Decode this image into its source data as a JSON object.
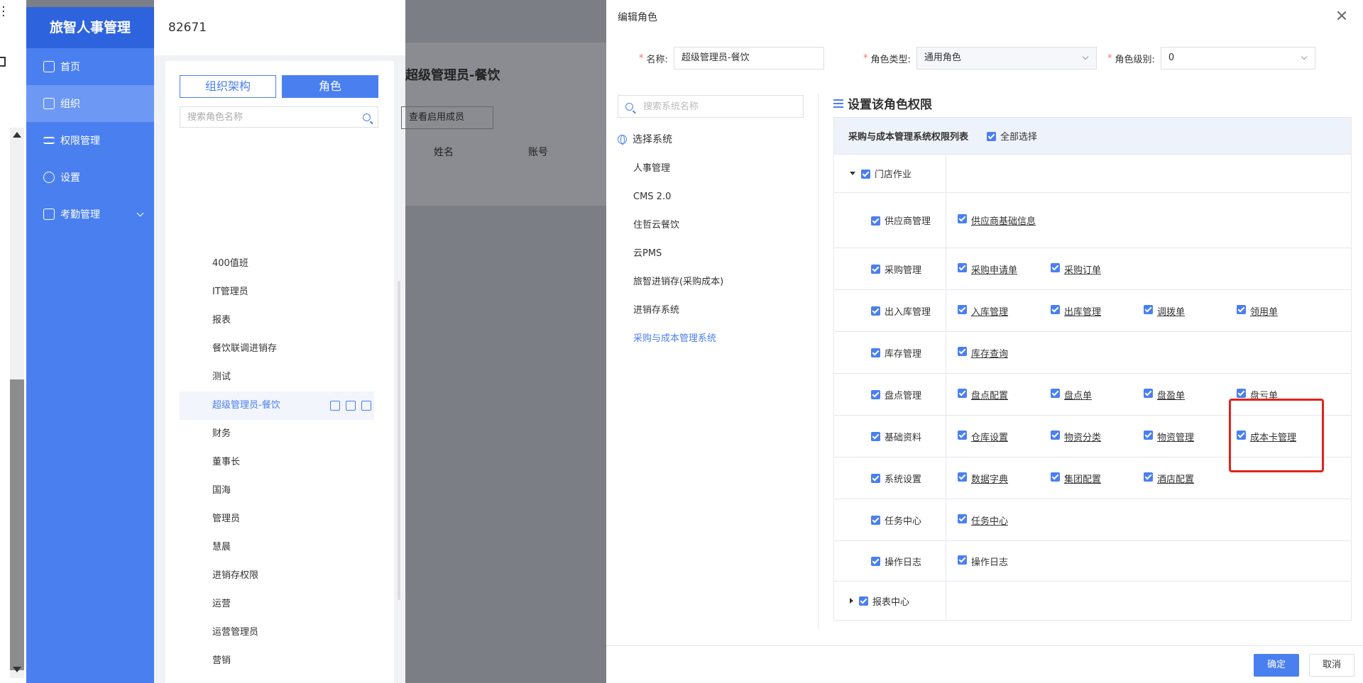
{
  "sidebar": {
    "brand": "旅智人事管理",
    "items": [
      {
        "label": "首页"
      },
      {
        "label": "组织"
      },
      {
        "label": "权限管理"
      },
      {
        "label": "设置"
      },
      {
        "label": "考勤管理"
      }
    ]
  },
  "left_panel": {
    "top_text": "82671",
    "tabs": [
      "组织架构",
      "角色"
    ],
    "search_placeholder": "搜索角色名称",
    "roles": [
      "400值班",
      "IT管理员",
      "报表",
      "餐饮联调进销存",
      "测试",
      "超级管理员-餐饮",
      "财务",
      "董事长",
      "国海",
      "管理员",
      "慧晨",
      "进销存权限",
      "运营",
      "运营管理员",
      "营销"
    ]
  },
  "middle": {
    "title": "超级管理员-餐饮",
    "select": "查看启用成员",
    "columns": [
      "姓名",
      "账号"
    ]
  },
  "dialog": {
    "title": "编辑角色",
    "name_label": "名称:",
    "name_value": "超级管理员-餐饮",
    "type_label": "角色类型:",
    "type_value": "通用角色",
    "level_label": "角色级别:",
    "level_value": "0",
    "sys_search_placeholder": "搜索系统名称",
    "sys_header": "选择系统",
    "systems": [
      "人事管理",
      "CMS 2.0",
      "住哲云餐饮",
      "云PMS",
      "旅智进销存(采购成本)",
      "进销存系统",
      "采购与成本管理系统"
    ],
    "perm_title": "设置该角色权限",
    "table_title": "采购与成本管理系统权限列表",
    "select_all": "全部选择",
    "groups": [
      {
        "name": "门店作业",
        "items": []
      },
      {
        "name": "供应商管理",
        "items": [
          "供应商基础信息"
        ]
      },
      {
        "name": "采购管理",
        "items": [
          "采购申请单",
          "采购订单"
        ]
      },
      {
        "name": "出入库管理",
        "items": [
          "入库管理",
          "出库管理",
          "调拨单",
          "领用单"
        ]
      },
      {
        "name": "库存管理",
        "items": [
          "库存查询"
        ]
      },
      {
        "name": "盘点管理",
        "items": [
          "盘点配置",
          "盘点单",
          "盘盈单",
          "盘亏单"
        ]
      },
      {
        "name": "基础资料",
        "items": [
          "仓库设置",
          "物资分类",
          "物资管理",
          "成本卡管理"
        ]
      },
      {
        "name": "系统设置",
        "items": [
          "数据字典",
          "集团配置",
          "酒店配置"
        ]
      },
      {
        "name": "任务中心",
        "items": [
          "任务中心"
        ]
      },
      {
        "name": "操作日志",
        "items": [
          "操作日志"
        ]
      },
      {
        "name": "报表中心",
        "items": []
      }
    ],
    "ok": "确定",
    "cancel": "取消"
  },
  "colors": {
    "primary": "#4a7ff0",
    "sidebar": "#4a7ff0",
    "brand": "#2d64de",
    "highlight": "#e0241b"
  }
}
